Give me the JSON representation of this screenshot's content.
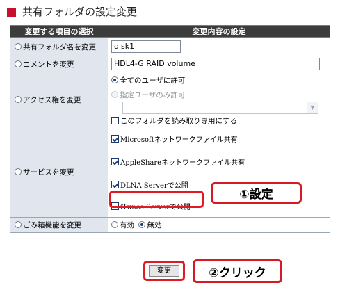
{
  "title": "共有フォルダの設定変更",
  "table": {
    "header_left": "変更する項目の選択",
    "header_right": "変更内容の設定"
  },
  "rows": {
    "share_name": {
      "label": "共有フォルダ名を変更",
      "value": "disk1"
    },
    "comment": {
      "label": "コメントを変更",
      "value": "HDL4-G RAID volume"
    },
    "access": {
      "label": "アクセス権を変更",
      "allow_all": "全てのユーザに許可",
      "allow_specific": "指定ユーザのみ許可",
      "read_only": "このフォルダを読み取り専用にする"
    },
    "services": {
      "label": "サービスを変更",
      "microsoft": "Microsoftネットワークファイル共有",
      "apple": "AppleShareネットワークファイル共有",
      "dlna": "DLNA Serverで公開",
      "itunes": "iTunes Serverで公開"
    },
    "trash": {
      "label": "ごみ箱機能を変更",
      "enable": "有効",
      "disable": "無効"
    }
  },
  "button": {
    "change": "変更"
  },
  "annotations": {
    "step1": "①設定",
    "step2": "②クリック"
  },
  "colors": {
    "accent": "#d71a21",
    "header_bg": "#3c3c3c",
    "left_cell_bg": "#e0e5ee"
  }
}
